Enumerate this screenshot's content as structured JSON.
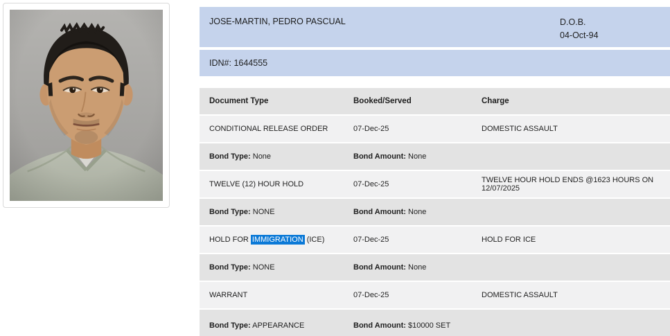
{
  "inmate": {
    "name": "JOSE-MARTIN, PEDRO PASCUAL",
    "dob_label": "D.O.B.",
    "dob_value": "04-Oct-94",
    "idn_label": "IDN#:",
    "idn_value": "1644555"
  },
  "photo": {
    "description": "booking-mugshot-photo"
  },
  "table": {
    "headers": [
      "Document Type",
      "Booked/Served",
      "Charge"
    ],
    "bond_type_label": "Bond Type:",
    "bond_amount_label": "Bond Amount:",
    "rows": [
      {
        "kind": "document",
        "document": "CONDITIONAL RELEASE ORDER",
        "booked": "07-Dec-25",
        "charge": "DOMESTIC ASSAULT"
      },
      {
        "kind": "bond",
        "bond_type": "None",
        "bond_amount": "None"
      },
      {
        "kind": "document",
        "document": "TWELVE (12) HOUR HOLD",
        "booked": "07-Dec-25",
        "charge": "TWELVE HOUR HOLD ENDS @1623 HOURS ON 12/07/2025"
      },
      {
        "kind": "bond",
        "bond_type": "NONE",
        "bond_amount": "None"
      },
      {
        "kind": "document",
        "document_prefix": "HOLD FOR ",
        "document_highlight": "IMMIGRATION",
        "document_suffix": " (ICE)",
        "booked": "07-Dec-25",
        "charge": "HOLD FOR ICE"
      },
      {
        "kind": "bond",
        "bond_type": "NONE",
        "bond_amount": "None"
      },
      {
        "kind": "document",
        "document": "WARRANT",
        "booked": "07-Dec-25",
        "charge": "DOMESTIC ASSAULT"
      },
      {
        "kind": "bond",
        "bond_type": "APPEARANCE",
        "bond_amount": "$10000 SET"
      }
    ]
  },
  "colors": {
    "header_bar_blue": "#c5d3ec",
    "highlight_blue": "#0b79d7",
    "row_gray": "#e3e3e3",
    "row_light": "#f1f1f2"
  }
}
